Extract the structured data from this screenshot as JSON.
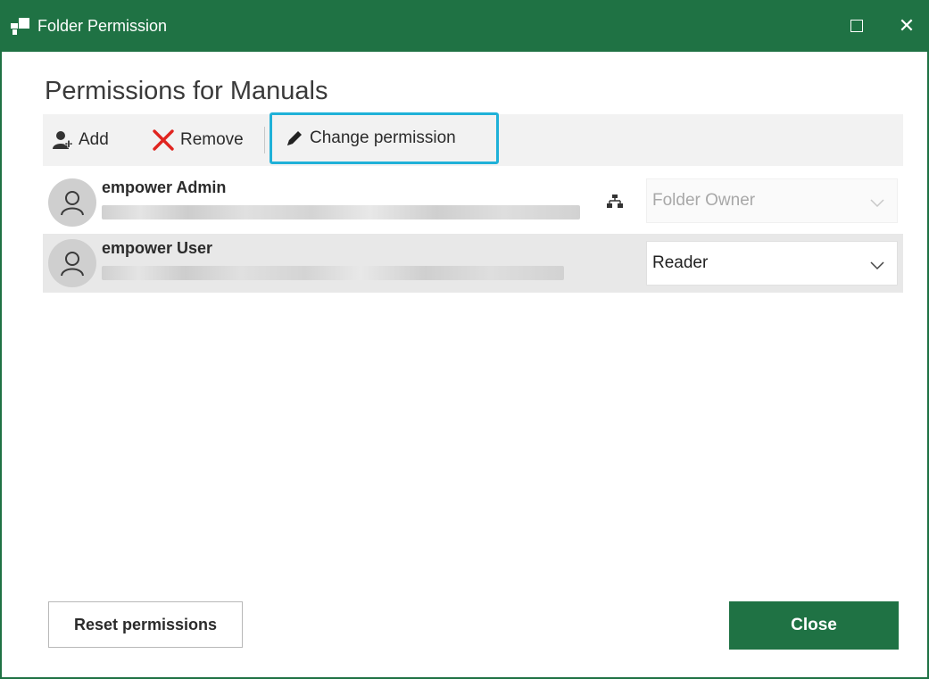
{
  "window": {
    "title": "Folder Permission",
    "accent_color": "#1f7244",
    "maximize_icon": "maximize-icon",
    "close_icon": "close-icon"
  },
  "heading": "Permissions for Manuals",
  "toolbar": {
    "add_label": "Add",
    "remove_label": "Remove",
    "change_label": "Change permission",
    "highlight_color": "#1fb1d8"
  },
  "users": [
    {
      "name": "empower Admin",
      "permission": "Folder Owner",
      "inherited_icon": "hierarchy-icon",
      "editable": false
    },
    {
      "name": "empower User",
      "permission": "Reader",
      "editable": true
    }
  ],
  "footer": {
    "reset_label": "Reset permissions",
    "close_label": "Close"
  }
}
